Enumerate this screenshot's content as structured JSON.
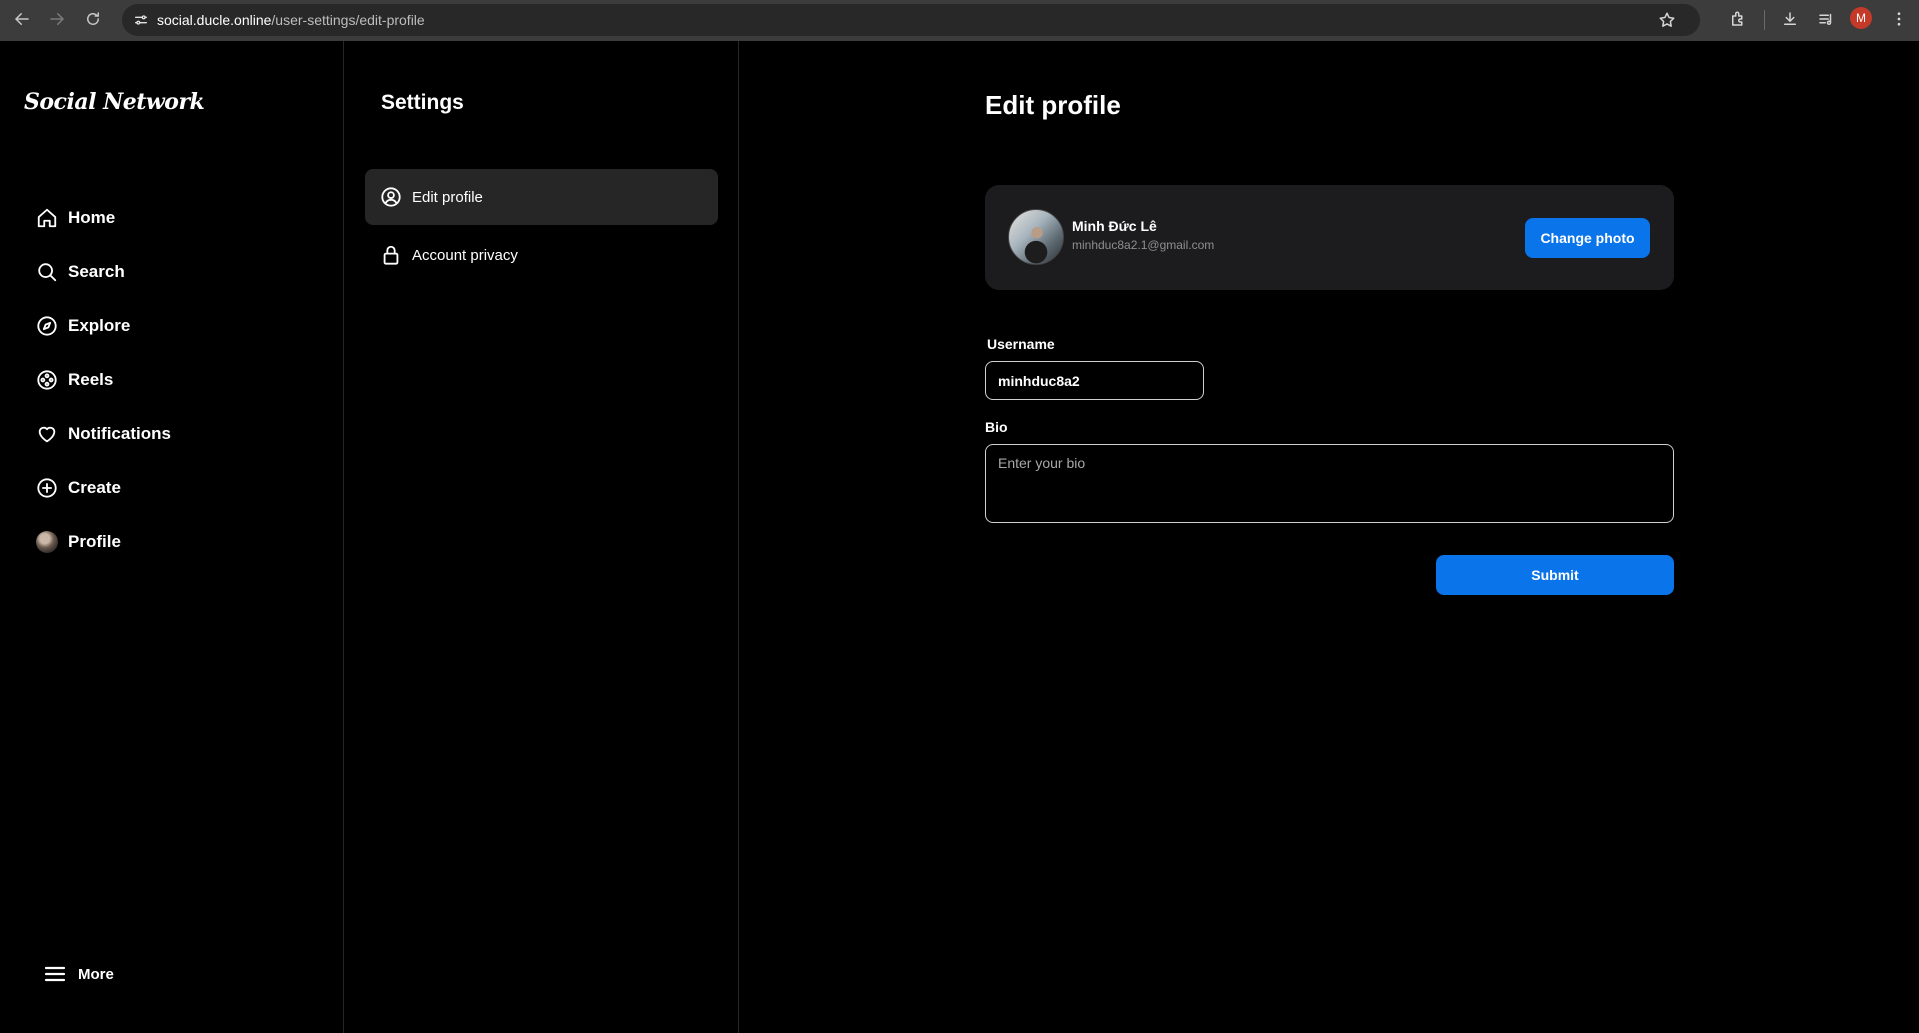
{
  "browser": {
    "url_domain": "social.ducle.online",
    "url_path": "/user-settings/edit-profile",
    "profile_initial": "M"
  },
  "sidebar": {
    "logo": "Social Network",
    "items": [
      {
        "label": "Home",
        "icon": "home-icon"
      },
      {
        "label": "Search",
        "icon": "search-icon"
      },
      {
        "label": "Explore",
        "icon": "compass-icon"
      },
      {
        "label": "Reels",
        "icon": "reels-icon"
      },
      {
        "label": "Notifications",
        "icon": "heart-icon"
      },
      {
        "label": "Create",
        "icon": "plus-circle-icon"
      },
      {
        "label": "Profile",
        "icon": "avatar"
      }
    ],
    "more_label": "More"
  },
  "settings": {
    "title": "Settings",
    "items": [
      {
        "label": "Edit profile",
        "icon": "user-circle-icon",
        "active": true
      },
      {
        "label": "Account privacy",
        "icon": "lock-icon",
        "active": false
      }
    ]
  },
  "main": {
    "title": "Edit profile",
    "profile": {
      "name": "Minh Đức Lê",
      "email": "minhduc8a2.1@gmail.com",
      "change_photo_label": "Change photo"
    },
    "username_label": "Username",
    "username_value": "minhduc8a2",
    "bio_label": "Bio",
    "bio_placeholder": "Enter your bio",
    "submit_label": "Submit"
  },
  "colors": {
    "accent": "#0a74ea",
    "background": "#000000",
    "card": "#1c1c1e",
    "active_item": "#262626"
  }
}
